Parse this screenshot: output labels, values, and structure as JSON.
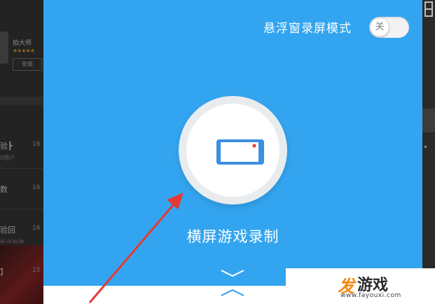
{
  "background_app": {
    "app_name": "拍大师",
    "app_rating": "★★★★★",
    "app_button": "安装",
    "rows": [
      {
        "title": "验┣",
        "sub": "0用户",
        "num": "16"
      },
      {
        "title": "数",
        "sub": "",
        "num": "16"
      },
      {
        "title": "验回",
        "sub": "al oracle",
        "num": "16"
      },
      {
        "title": "】",
        "sub": "",
        "num": "15"
      }
    ]
  },
  "panel": {
    "floating_mode_label": "悬浮窗录屏模式",
    "toggle_state_label": "关",
    "record_label": "横屏游戏录制"
  },
  "watermark": {
    "brand_accent": "发",
    "brand_text": "游戏",
    "url": "www.fayouxi.com"
  },
  "colors": {
    "panel_blue": "#33a5f0",
    "phone_blue": "#3d8fe0",
    "record_dot_red": "#e8432e",
    "arrow_red": "#e53935",
    "brand_orange": "#f28a14"
  },
  "icons": {
    "record": "landscape-phone-icon",
    "expand": "chevron-down-icon",
    "collapse": "chevron-up-icon"
  }
}
